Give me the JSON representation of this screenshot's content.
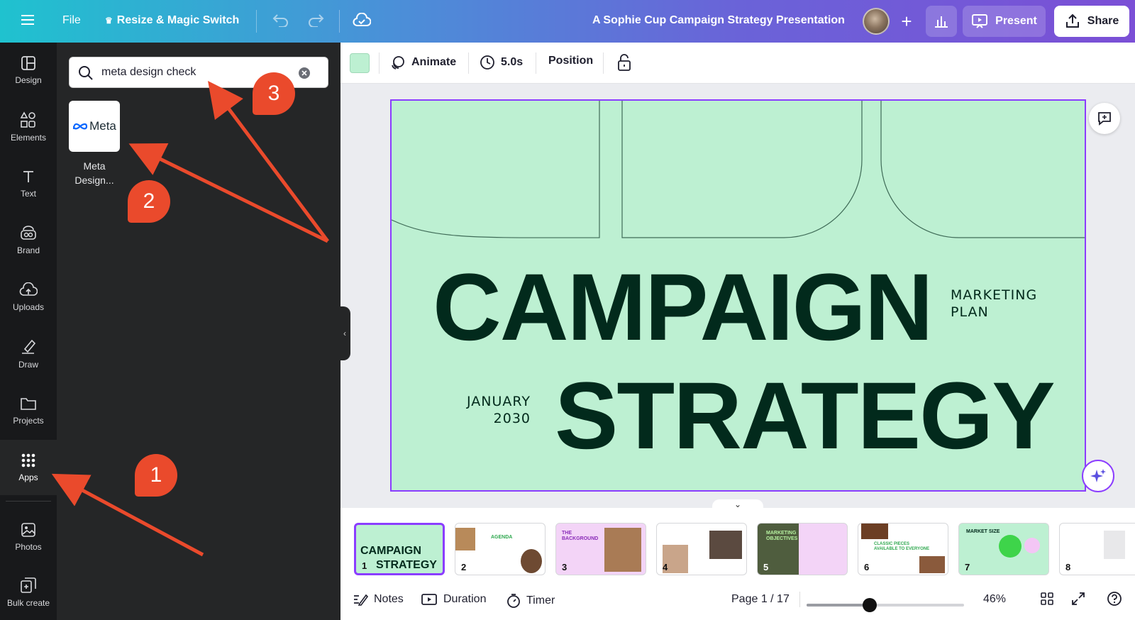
{
  "topbar": {
    "file_label": "File",
    "resize_label": "Resize & Magic Switch",
    "doc_title": "A Sophie Cup Campaign Strategy Presentation",
    "present_label": "Present",
    "share_label": "Share"
  },
  "rail": {
    "items": [
      {
        "label": "Design",
        "icon": "design-icon"
      },
      {
        "label": "Elements",
        "icon": "elements-icon"
      },
      {
        "label": "Text",
        "icon": "text-icon"
      },
      {
        "label": "Brand",
        "icon": "brand-icon"
      },
      {
        "label": "Uploads",
        "icon": "uploads-icon"
      },
      {
        "label": "Draw",
        "icon": "draw-icon"
      },
      {
        "label": "Projects",
        "icon": "projects-icon"
      },
      {
        "label": "Apps",
        "icon": "apps-icon"
      },
      {
        "label": "Photos",
        "icon": "photos-icon"
      },
      {
        "label": "Bulk create",
        "icon": "bulk-create-icon"
      }
    ]
  },
  "panel": {
    "search_value": "meta design check",
    "app_logo_text": "Meta",
    "app_name": "Meta Design..."
  },
  "context_toolbar": {
    "swatch_color": "#bdf0d2",
    "animate_label": "Animate",
    "duration_label": "5.0s",
    "position_label": "Position"
  },
  "slide": {
    "word1": "CAMPAIGN",
    "word2": "STRATEGY",
    "subtitle_line1": "MARKETING",
    "subtitle_line2": "PLAN",
    "date_line1": "JANUARY",
    "date_line2": "2030",
    "bg_color": "#bdf0d2",
    "text_color": "#022a1c"
  },
  "thumbnails": [
    {
      "num": "1",
      "title_a": "CAMPAIGN",
      "title_b": "STRATEGY"
    },
    {
      "num": "2",
      "title_a": "AGENDA"
    },
    {
      "num": "3",
      "title_a": "THE",
      "title_b": "BACKGROUND"
    },
    {
      "num": "4"
    },
    {
      "num": "5",
      "title_a": "MARKETING",
      "title_b": "OBJECTIVES"
    },
    {
      "num": "6",
      "title_a": "CLASSIC PIECES",
      "title_b": "AVAILABLE TO EVERYONE"
    },
    {
      "num": "7",
      "title_a": "MARKET SIZE"
    },
    {
      "num": "8"
    }
  ],
  "bottombar": {
    "notes_label": "Notes",
    "duration_label": "Duration",
    "timer_label": "Timer",
    "page_label": "Page 1 / 17",
    "zoom_label": "46%",
    "zoom_fraction": 0.4
  },
  "annotations": [
    {
      "num": "1"
    },
    {
      "num": "2"
    },
    {
      "num": "3"
    }
  ],
  "colors": {
    "accent": "#8b3dff",
    "annotation": "#ea4a2c"
  }
}
